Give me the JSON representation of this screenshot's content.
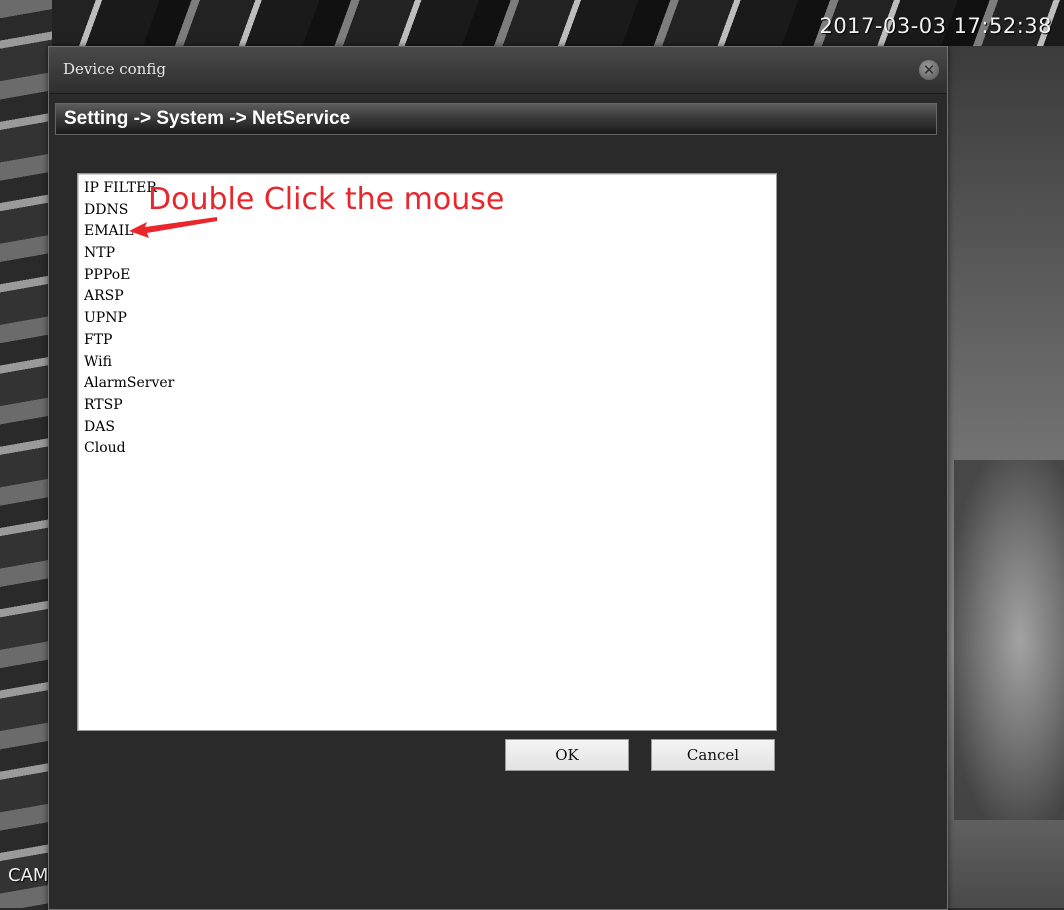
{
  "overlay": {
    "timestamp": "2017-03-03 17:52:38",
    "camera_label": "CAM"
  },
  "dialog": {
    "title": "Device config",
    "breadcrumb": "Setting -> System -> NetService",
    "close_icon": "close-icon",
    "items": [
      "IP FILTER",
      "DDNS",
      "EMAIL",
      "NTP",
      "PPPoE",
      "ARSP",
      "UPNP",
      "FTP",
      "Wifi",
      "AlarmServer",
      "RTSP",
      "DAS",
      "Cloud"
    ],
    "ok_label": "OK",
    "cancel_label": "Cancel"
  },
  "annotation": {
    "text": "Double Click the mouse",
    "color": "#e8262c"
  }
}
